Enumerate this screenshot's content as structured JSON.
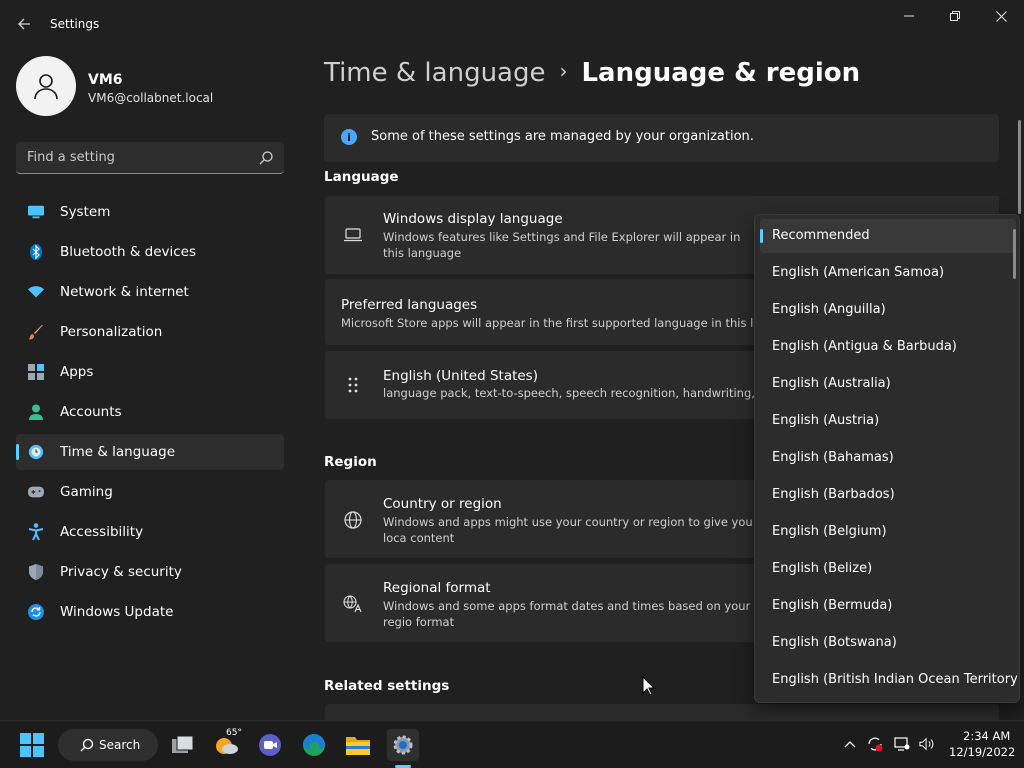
{
  "window": {
    "title": "Settings"
  },
  "profile": {
    "name": "VM6",
    "email": "VM6@collabnet.local"
  },
  "search": {
    "placeholder": "Find a setting"
  },
  "nav": {
    "items": [
      {
        "label": "System",
        "icon": "monitor-icon"
      },
      {
        "label": "Bluetooth & devices",
        "icon": "bluetooth-icon"
      },
      {
        "label": "Network & internet",
        "icon": "wifi-icon"
      },
      {
        "label": "Personalization",
        "icon": "brush-icon"
      },
      {
        "label": "Apps",
        "icon": "apps-icon"
      },
      {
        "label": "Accounts",
        "icon": "person-icon"
      },
      {
        "label": "Time & language",
        "icon": "globe-clock-icon",
        "selected": true
      },
      {
        "label": "Gaming",
        "icon": "gamepad-icon"
      },
      {
        "label": "Accessibility",
        "icon": "accessibility-icon"
      },
      {
        "label": "Privacy & security",
        "icon": "shield-icon"
      },
      {
        "label": "Windows Update",
        "icon": "refresh-icon"
      }
    ]
  },
  "breadcrumb": {
    "parent": "Time & language",
    "separator": "›",
    "current": "Language & region"
  },
  "info": {
    "text": "Some of these settings are managed by your organization."
  },
  "sections": {
    "language": "Language",
    "region": "Region",
    "related": "Related settings"
  },
  "cards": {
    "display_language": {
      "title": "Windows display language",
      "desc": "Windows features like Settings and File Explorer will appear in this language"
    },
    "preferred": {
      "title": "Preferred languages",
      "desc": "Microsoft Store apps will appear in the first supported language in this list"
    },
    "english_us": {
      "title": "English (United States)",
      "desc": "language pack, text-to-speech, speech recognition, handwriting, bas"
    },
    "country": {
      "title": "Country or region",
      "desc": "Windows and apps might use your country or region to give you loca content"
    },
    "regional_format": {
      "title": "Regional format",
      "desc": "Windows and some apps format dates and times based on your regio format"
    }
  },
  "dropdown": {
    "options": [
      "Recommended",
      "English (American Samoa)",
      "English (Anguilla)",
      "English (Antigua & Barbuda)",
      "English (Australia)",
      "English (Austria)",
      "English (Bahamas)",
      "English (Barbados)",
      "English (Belgium)",
      "English (Belize)",
      "English (Bermuda)",
      "English (Botswana)",
      "English (British Indian Ocean Territory)"
    ],
    "selected_index": 0
  },
  "taskbar": {
    "search_label": "Search",
    "weather_temp": "65°",
    "time": "2:34 AM",
    "date": "12/19/2022"
  },
  "colors": {
    "accent": "#60cdff",
    "background": "#202020",
    "card": "#2b2b2b",
    "info": "#4ca6ff"
  }
}
